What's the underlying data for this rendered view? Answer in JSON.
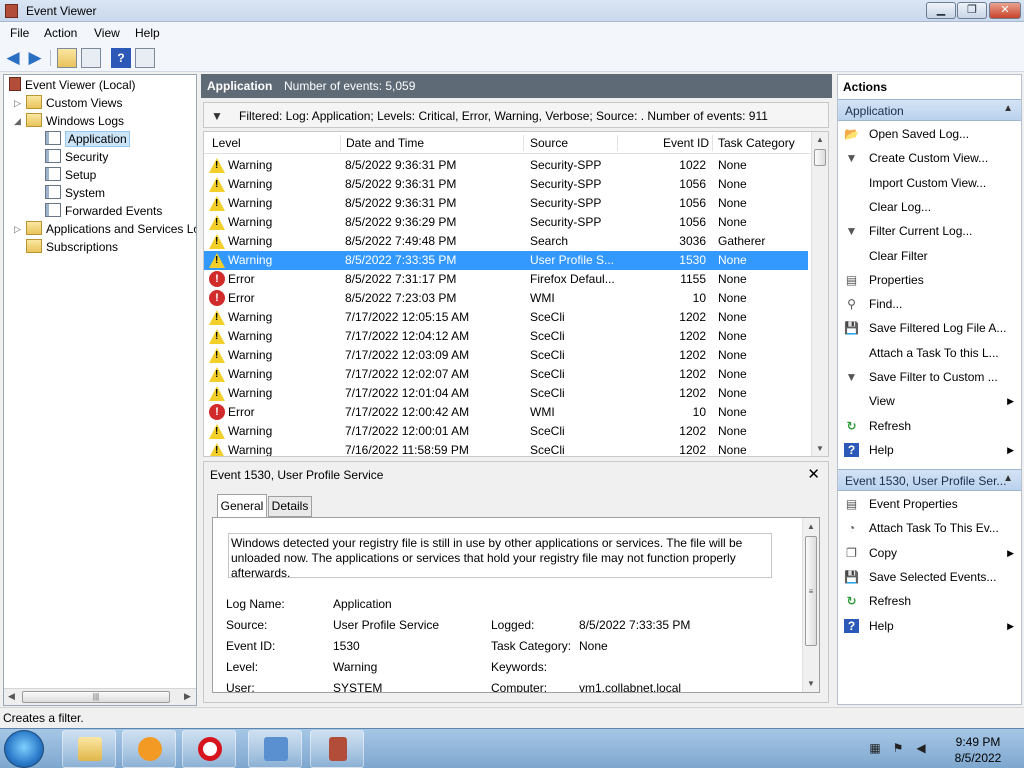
{
  "window": {
    "title": "Event Viewer",
    "minimize": "0",
    "maximize": "1",
    "close": "X"
  },
  "menu": [
    "File",
    "Action",
    "View",
    "Help"
  ],
  "tree": {
    "items": [
      {
        "label": "Event Viewer (Local)"
      },
      {
        "label": "Custom Views"
      },
      {
        "label": "Windows Logs"
      },
      {
        "label": "Application"
      },
      {
        "label": "Security"
      },
      {
        "label": "Setup"
      },
      {
        "label": "System"
      },
      {
        "label": "Forwarded Events"
      },
      {
        "label": "Applications and Services Lo"
      },
      {
        "label": "Subscriptions"
      }
    ],
    "selected": "Application"
  },
  "center": {
    "title": "Application",
    "count_text": "Number of events: 5,059",
    "filter_text": "Filtered: Log: Application; Levels: Critical, Error, Warning, Verbose; Source: . Number of events: 911",
    "columns": [
      "Level",
      "Date and Time",
      "Source",
      "Event ID",
      "Task Category"
    ],
    "rows": [
      {
        "level": "Warning",
        "date": "8/5/2022 9:36:31 PM",
        "source": "Security-SPP",
        "id": "1022",
        "task": "None"
      },
      {
        "level": "Warning",
        "date": "8/5/2022 9:36:31 PM",
        "source": "Security-SPP",
        "id": "1056",
        "task": "None"
      },
      {
        "level": "Warning",
        "date": "8/5/2022 9:36:31 PM",
        "source": "Security-SPP",
        "id": "1056",
        "task": "None"
      },
      {
        "level": "Warning",
        "date": "8/5/2022 9:36:29 PM",
        "source": "Security-SPP",
        "id": "1056",
        "task": "None"
      },
      {
        "level": "Warning",
        "date": "8/5/2022 7:49:48 PM",
        "source": "Search",
        "id": "3036",
        "task": "Gatherer"
      },
      {
        "level": "Warning",
        "date": "8/5/2022 7:33:35 PM",
        "source": "User Profile S...",
        "id": "1530",
        "task": "None"
      },
      {
        "level": "Error",
        "date": "8/5/2022 7:31:17 PM",
        "source": "Firefox Defaul...",
        "id": "1155",
        "task": "None"
      },
      {
        "level": "Error",
        "date": "8/5/2022 7:23:03 PM",
        "source": "WMI",
        "id": "10",
        "task": "None"
      },
      {
        "level": "Warning",
        "date": "7/17/2022 12:05:15 AM",
        "source": "SceCli",
        "id": "1202",
        "task": "None"
      },
      {
        "level": "Warning",
        "date": "7/17/2022 12:04:12 AM",
        "source": "SceCli",
        "id": "1202",
        "task": "None"
      },
      {
        "level": "Warning",
        "date": "7/17/2022 12:03:09 AM",
        "source": "SceCli",
        "id": "1202",
        "task": "None"
      },
      {
        "level": "Warning",
        "date": "7/17/2022 12:02:07 AM",
        "source": "SceCli",
        "id": "1202",
        "task": "None"
      },
      {
        "level": "Warning",
        "date": "7/17/2022 12:01:04 AM",
        "source": "SceCli",
        "id": "1202",
        "task": "None"
      },
      {
        "level": "Error",
        "date": "7/17/2022 12:00:42 AM",
        "source": "WMI",
        "id": "10",
        "task": "None"
      },
      {
        "level": "Warning",
        "date": "7/17/2022 12:00:01 AM",
        "source": "SceCli",
        "id": "1202",
        "task": "None"
      },
      {
        "level": "Warning",
        "date": "7/16/2022 11:58:59 PM",
        "source": "SceCli",
        "id": "1202",
        "task": "None"
      }
    ],
    "selected_row": 5
  },
  "detail": {
    "title": "Event 1530, User Profile Service",
    "close": "✕",
    "tabs": [
      "General",
      "Details"
    ],
    "description": "Windows detected your registry file is still in use by other applications or services. The file will be unloaded now. The applications or services that hold your registry file may not function properly afterwards.",
    "fields": {
      "log_name_label": "Log Name:",
      "log_name": "Application",
      "source_label": "Source:",
      "source": "User Profile Service",
      "logged_label": "Logged:",
      "logged": "8/5/2022 7:33:35 PM",
      "event_id_label": "Event ID:",
      "event_id": "1530",
      "task_label": "Task Category:",
      "task": "None",
      "level_label": "Level:",
      "level": "Warning",
      "keywords_label": "Keywords:",
      "user_label": "User:",
      "user": "SYSTEM",
      "computer_label": "Computer:",
      "computer": "vm1.collabnet.local"
    }
  },
  "actions": {
    "title": "Actions",
    "section1": "Application",
    "items1": [
      {
        "label": "Open Saved Log...",
        "icon": "folder-icon"
      },
      {
        "label": "Create Custom View...",
        "icon": "funnel-icon"
      },
      {
        "label": "Import Custom View...",
        "icon": ""
      },
      {
        "label": "Clear Log...",
        "icon": ""
      },
      {
        "label": "Filter Current Log...",
        "icon": "funnel-icon"
      },
      {
        "label": "Clear Filter",
        "icon": ""
      },
      {
        "label": "Properties",
        "icon": "properties-icon"
      },
      {
        "label": "Find...",
        "icon": "binoculars-icon"
      },
      {
        "label": "Save Filtered Log File A...",
        "icon": "save-icon"
      },
      {
        "label": "Attach a Task To this L...",
        "icon": ""
      },
      {
        "label": "Save Filter to Custom ...",
        "icon": "funnel-icon"
      },
      {
        "label": "View",
        "icon": "",
        "submenu": true
      },
      {
        "label": "Refresh",
        "icon": "refresh-icon"
      },
      {
        "label": "Help",
        "icon": "help-icon",
        "submenu": true
      }
    ],
    "section2": "Event 1530, User Profile Ser...",
    "items2": [
      {
        "label": "Event Properties",
        "icon": "properties-icon"
      },
      {
        "label": "Attach Task To This Ev...",
        "icon": "task-icon"
      },
      {
        "label": "Copy",
        "icon": "copy-icon",
        "submenu": true
      },
      {
        "label": "Save Selected Events...",
        "icon": "save-icon"
      },
      {
        "label": "Refresh",
        "icon": "refresh-icon"
      },
      {
        "label": "Help",
        "icon": "help-icon",
        "submenu": true
      }
    ]
  },
  "status": {
    "text": "Creates a filter."
  },
  "taskbar": {
    "time": "9:49 PM",
    "date": "8/5/2022"
  },
  "colors": {
    "selection": "#3399ff",
    "header": "#5f6a77",
    "warning": "#f2cf29",
    "error": "#d12b2b"
  }
}
